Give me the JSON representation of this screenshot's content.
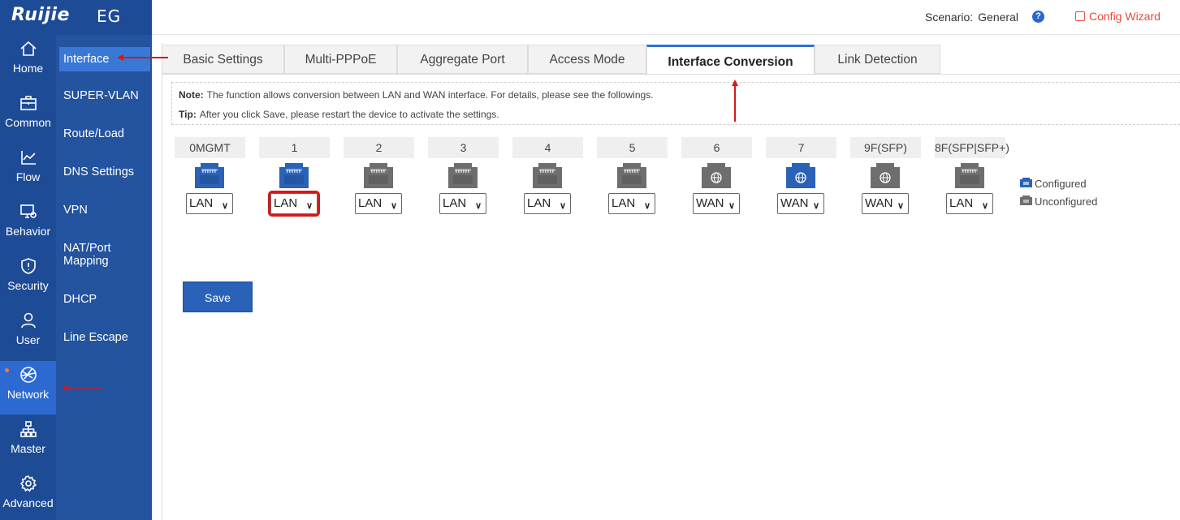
{
  "brand": {
    "logo": "Ruijie",
    "suffix": "EG"
  },
  "header": {
    "scenario_label": "Scenario:",
    "scenario_value": "General",
    "help_symbol": "?",
    "config_wizard": "Config Wizard"
  },
  "nav": [
    {
      "label": "Home",
      "icon": "home-icon"
    },
    {
      "label": "Common",
      "icon": "briefcase-icon"
    },
    {
      "label": "Flow",
      "icon": "chart-line-icon"
    },
    {
      "label": "Behavior",
      "icon": "monitor-icon"
    },
    {
      "label": "Security",
      "icon": "shield-icon"
    },
    {
      "label": "User",
      "icon": "user-icon"
    },
    {
      "label": "Network",
      "icon": "globe-icon",
      "active": true
    },
    {
      "label": "Master",
      "icon": "topology-icon"
    },
    {
      "label": "Advanced",
      "icon": "gear-icon"
    }
  ],
  "submenu": [
    {
      "label": "Interface",
      "active": true
    },
    {
      "label": "SUPER-VLAN"
    },
    {
      "label": "Route/Load"
    },
    {
      "label": "DNS Settings"
    },
    {
      "label": "VPN"
    },
    {
      "label": "NAT/Port Mapping"
    },
    {
      "label": "DHCP"
    },
    {
      "label": "Line Escape"
    }
  ],
  "tabs": [
    {
      "label": "Basic Settings"
    },
    {
      "label": "Multi-PPPoE"
    },
    {
      "label": "Aggregate Port"
    },
    {
      "label": "Access Mode"
    },
    {
      "label": "Interface Conversion",
      "active": true
    },
    {
      "label": "Link Detection"
    }
  ],
  "note": {
    "note_label": "Note:",
    "note_text": "The function allows conversion between LAN and WAN interface. For details, please see the followings.",
    "tip_label": "Tip:",
    "tip_text": "After you click Save, please restart the device to activate the settings."
  },
  "ports": [
    {
      "name": "0MGMT",
      "value": "LAN",
      "configured": true,
      "wan": false
    },
    {
      "name": "1",
      "value": "LAN",
      "configured": true,
      "wan": false,
      "highlighted": true
    },
    {
      "name": "2",
      "value": "LAN",
      "configured": false,
      "wan": false
    },
    {
      "name": "3",
      "value": "LAN",
      "configured": false,
      "wan": false
    },
    {
      "name": "4",
      "value": "LAN",
      "configured": false,
      "wan": false
    },
    {
      "name": "5",
      "value": "LAN",
      "configured": false,
      "wan": false
    },
    {
      "name": "6",
      "value": "WAN",
      "configured": false,
      "wan": true
    },
    {
      "name": "7",
      "value": "WAN",
      "configured": true,
      "wan": true
    },
    {
      "name": "9F(SFP)",
      "value": "WAN",
      "configured": false,
      "wan": true
    },
    {
      "name": "8F(SFP|SFP+)",
      "value": "LAN",
      "configured": false,
      "wan": false
    }
  ],
  "legend": {
    "configured": "Configured",
    "unconfigured": "Unconfigured"
  },
  "save_label": "Save",
  "colors": {
    "brand": "#1e4b96",
    "accent": "#2f6fd2",
    "configured": "#2a62b8",
    "unconfigured": "#6e6e6e",
    "annotation": "#d61818",
    "wizard": "#e74c3c"
  }
}
